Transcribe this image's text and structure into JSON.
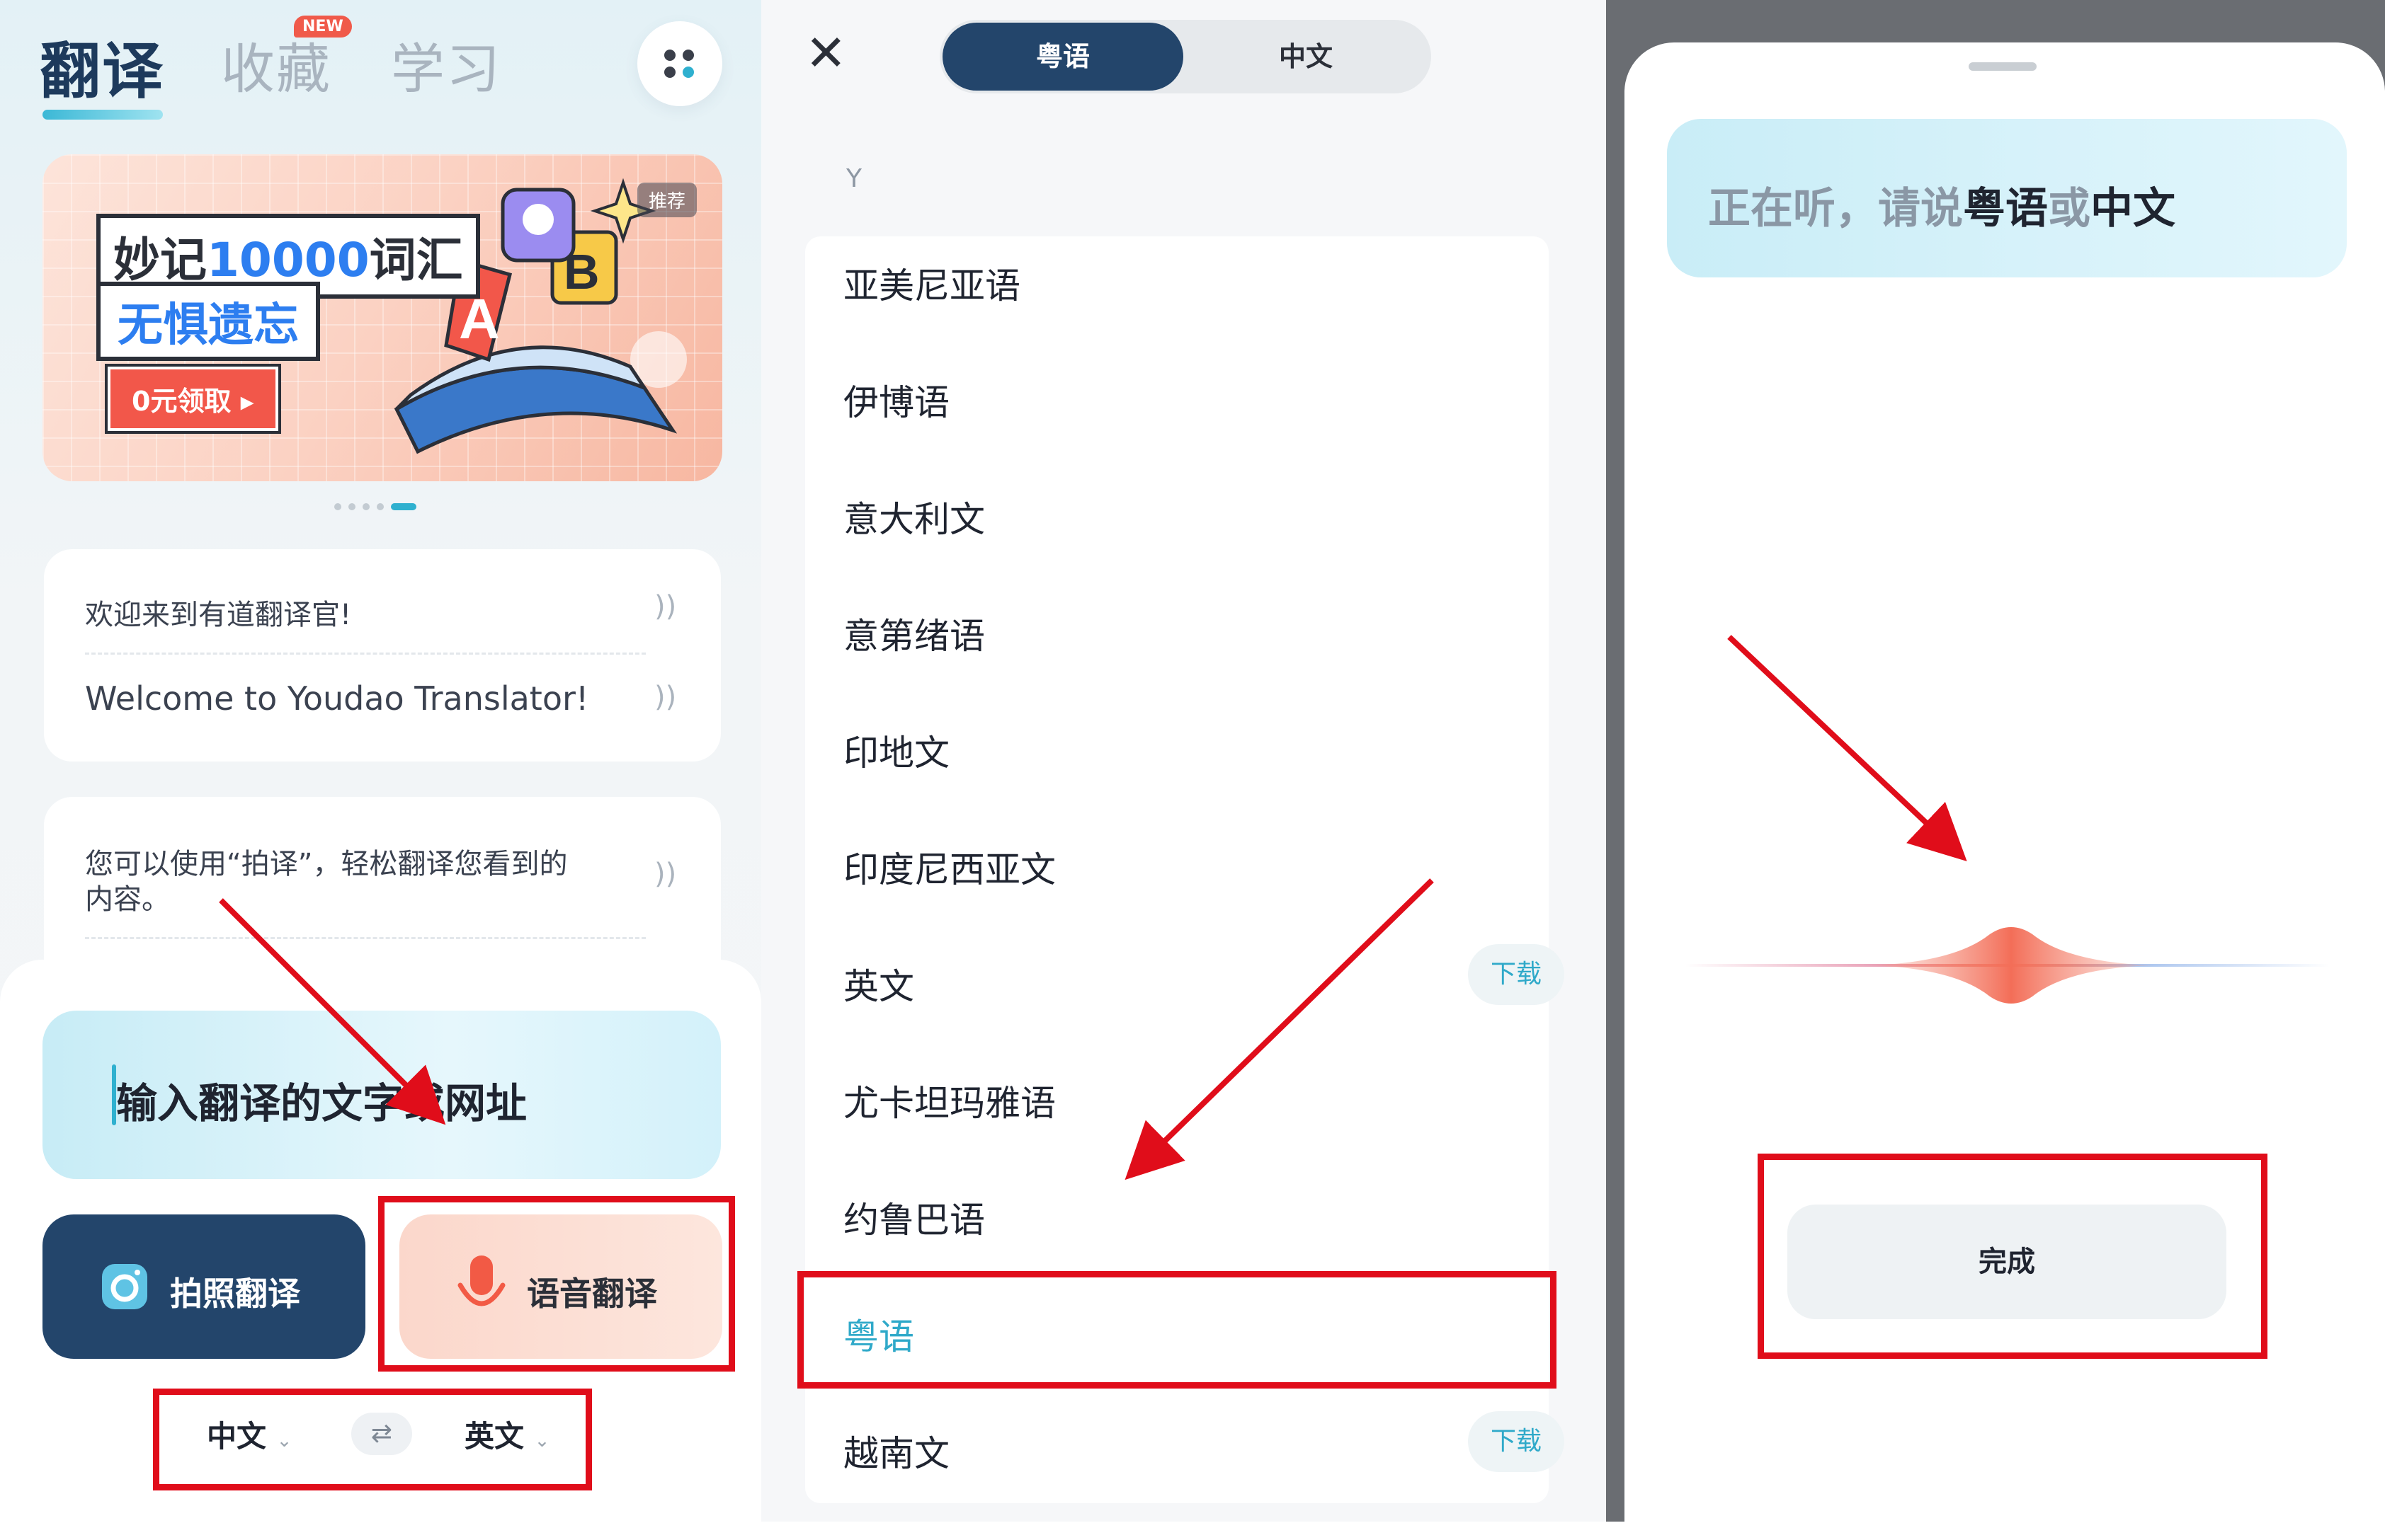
{
  "panel_home": {
    "tabs": [
      {
        "label": "翻译",
        "active": true
      },
      {
        "label": "收藏",
        "badge": "NEW"
      },
      {
        "label": "学习"
      }
    ],
    "banner": {
      "title_line1_prefix": "妙记",
      "title_line1_number": "10000",
      "title_line1_suffix": "词汇",
      "title_line2": "无惧遗忘",
      "cta": "0元领取 ▸",
      "tag": "推荐"
    },
    "welcome_card": {
      "zh": "欢迎来到有道翻译官!",
      "en": "Welcome to Youdao Translator!"
    },
    "tip_card": {
      "text_line1": "您可以使用“拍译”，轻松翻译您看到的",
      "text_line2": "内容。"
    },
    "input_placeholder": "输入翻译的文字或网址",
    "photo_button": "拍照翻译",
    "voice_button": "语音翻译",
    "source_lang": "中文",
    "target_lang": "英文",
    "swap_glyph": "⇄",
    "speaker_glyph": "))"
  },
  "panel_lang_select": {
    "close_glyph": "✕",
    "segments": [
      {
        "label": "粤语",
        "selected": true
      },
      {
        "label": "中文",
        "selected": false
      }
    ],
    "section_letter": "Y",
    "languages": [
      {
        "name": "亚美尼亚语"
      },
      {
        "name": "伊博语"
      },
      {
        "name": "意大利文"
      },
      {
        "name": "意第绪语"
      },
      {
        "name": "印地文"
      },
      {
        "name": "印度尼西亚文"
      },
      {
        "name": "英文",
        "action": "下载"
      },
      {
        "name": "尤卡坦玛雅语"
      },
      {
        "name": "约鲁巴语"
      },
      {
        "name": "粤语",
        "selected": true
      },
      {
        "name": "越南文",
        "action": "下载"
      }
    ]
  },
  "panel_listening": {
    "prompt_prefix": "正在听，请说",
    "prompt_lang1": "粤语",
    "prompt_mid": "或",
    "prompt_lang2": "中文",
    "done_button": "完成"
  },
  "colors": {
    "brand_navy": "#23456b",
    "accent_teal": "#2fa9c9",
    "annotation_red": "#e00d1a",
    "voice_coral": "#f06a55"
  }
}
